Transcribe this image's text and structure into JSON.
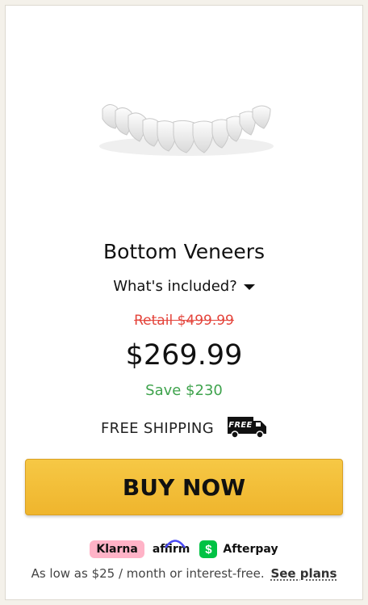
{
  "product": {
    "title": "Bottom Veneers",
    "included_label": "What's included?",
    "retail_price": "Retail $499.99",
    "price": "$269.99",
    "savings": "Save $230",
    "shipping_label": "FREE SHIPPING",
    "truck_badge": "FREE"
  },
  "cta": {
    "buy_label": "BUY NOW"
  },
  "payment": {
    "providers": [
      "Klarna",
      "affirm",
      "$",
      "Afterpay"
    ],
    "finance_text": "As low as $25 / month or interest-free.",
    "plans_link": "See plans"
  },
  "colors": {
    "retail_strike": "#e4443b",
    "savings_green": "#3fa34d",
    "button_yellow": "#f2bd3a",
    "klarna_pink": "#ffb3c7",
    "cashapp_green": "#00c244"
  },
  "icons": {
    "product_image": "bottom-veneers-image",
    "dropdown": "caret-down-icon",
    "shipping": "free-shipping-truck-icon"
  }
}
